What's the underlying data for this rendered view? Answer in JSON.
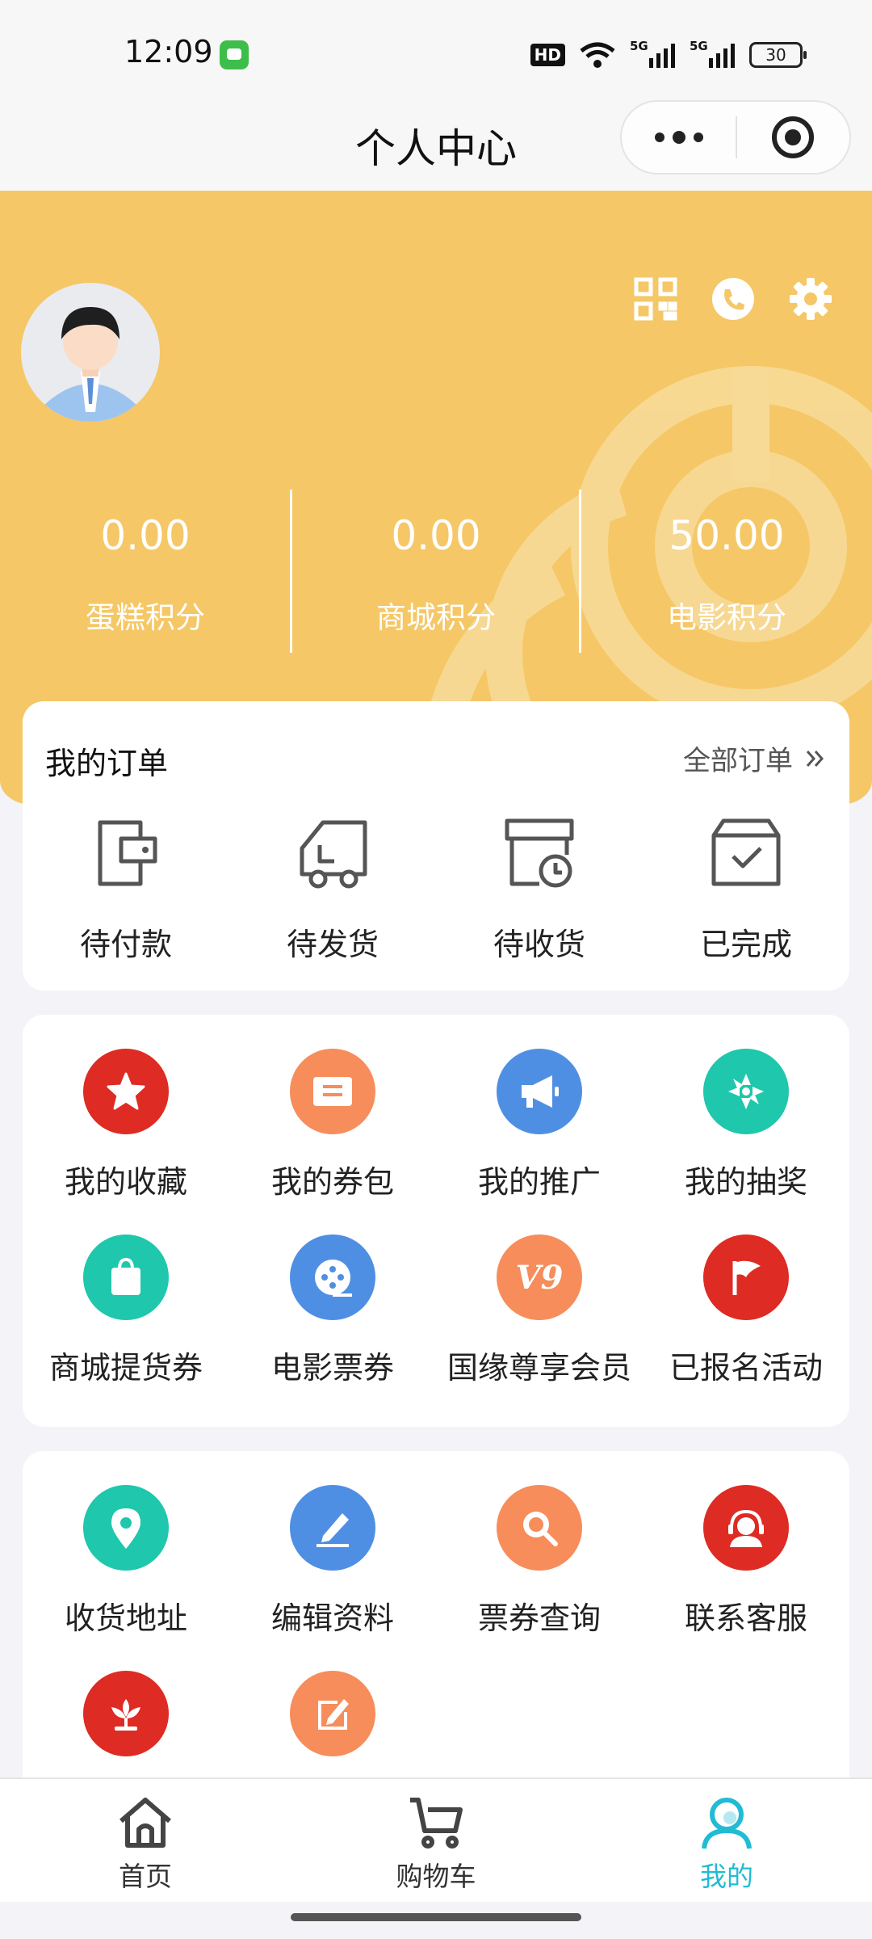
{
  "status_bar": {
    "time": "12:09",
    "hd": "HD",
    "net1": "5G",
    "net2": "5G",
    "battery": "30"
  },
  "nav": {
    "title": "个人中心"
  },
  "stats": [
    {
      "value": "0.00",
      "label": "蛋糕积分"
    },
    {
      "value": "0.00",
      "label": "商城积分"
    },
    {
      "value": "50.00",
      "label": "电影积分"
    }
  ],
  "orders": {
    "title": "我的订单",
    "all_label": "全部订单",
    "items": [
      {
        "label": "待付款",
        "icon": "wallet-icon"
      },
      {
        "label": "待发货",
        "icon": "truck-icon"
      },
      {
        "label": "待收货",
        "icon": "receive-clock-icon"
      },
      {
        "label": "已完成",
        "icon": "box-check-icon"
      }
    ]
  },
  "tools": [
    {
      "label": "我的收藏",
      "icon": "star-icon",
      "color": "#DE2B23"
    },
    {
      "label": "我的券包",
      "icon": "coupon-icon",
      "color": "#F68D5B"
    },
    {
      "label": "我的推广",
      "icon": "megaphone-icon",
      "color": "#4F8FE3"
    },
    {
      "label": "我的抽奖",
      "icon": "pinwheel-icon",
      "color": "#1FC7AC"
    },
    {
      "label": "商城提货券",
      "icon": "shopping-bag-icon",
      "color": "#1FC7AC"
    },
    {
      "label": "电影票券",
      "icon": "film-reel-icon",
      "color": "#4F8FE3"
    },
    {
      "label": "国缘尊享会员",
      "icon": "v9-badge-icon",
      "color": "#F68D5B",
      "badge_text": "V9"
    },
    {
      "label": "已报名活动",
      "icon": "flag-icon",
      "color": "#DE2B23"
    }
  ],
  "services": [
    {
      "label": "收货地址",
      "icon": "location-pin-icon",
      "color": "#1FC7AC"
    },
    {
      "label": "编辑资料",
      "icon": "pen-icon",
      "color": "#4F8FE3"
    },
    {
      "label": "票券查询",
      "icon": "magnifier-icon",
      "color": "#F68D5B"
    },
    {
      "label": "联系客服",
      "icon": "headset-agent-icon",
      "color": "#DE2B23"
    },
    {
      "label": "",
      "icon": "lotus-icon",
      "color": "#DE2B23"
    },
    {
      "label": "",
      "icon": "edit-note-icon",
      "color": "#F68D5B"
    }
  ],
  "tabs": [
    {
      "label": "首页",
      "icon": "home-icon",
      "active": false
    },
    {
      "label": "购物车",
      "icon": "cart-icon",
      "active": false
    },
    {
      "label": "我的",
      "icon": "profile-icon",
      "active": true
    }
  ],
  "colors": {
    "hero": "#F5C766",
    "accent": "#20BCD4",
    "page_bg": "#F4F3F8"
  }
}
